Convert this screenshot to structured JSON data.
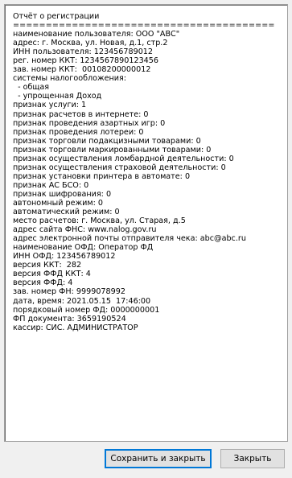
{
  "report": {
    "lines": [
      "Отчёт о регистрации",
      "========================================",
      "наименование пользователя: ООО \"АВС\"",
      "адрес: г. Москва, ул. Новая, д.1, стр.2",
      "ИНН пользователя: 123456789012",
      "рег. номер ККТ: 1234567890123456",
      "зав. номер ККТ:  00108200000012",
      "системы налогообложения:",
      "  - общая",
      "  - упрощенная Доход",
      "признак услуги: 1",
      "признак расчетов в интернете: 0",
      "признак проведения азартных игр: 0",
      "признак проведения лотереи: 0",
      "признак торговли подакцизными товарами: 0",
      "признак торговли маркированными товарами: 0",
      "признак осуществления ломбардной деятельности: 0",
      "признак осуществления страховой деятельности: 0",
      "признак установки принтера в автомате: 0",
      "признак АС БСО: 0",
      "признак шифрования: 0",
      "автономный режим: 0",
      "автоматический режим: 0",
      "место расчетов: г. Москва, ул. Старая, д.5",
      "адрес сайта ФНС: www.nalog.gov.ru",
      "адрес электронной почты отправителя чека: abc@abc.ru",
      "наименование ОФД: Оператор ФД",
      "ИНН ОФД: 123456789012",
      "версия ККТ:  282",
      "версия ФФД ККТ: 4",
      "версия ФФД: 4",
      "зав. номер ФН: 9999078992",
      "дата, время: 2021.05.15  17:46:00",
      "порядковый номер ФД: 0000000001",
      "ФП документа: 3659190524",
      "кассир: СИС. АДМИНИСТРАТОР"
    ]
  },
  "buttons": {
    "save_close": "Сохранить и закрыть",
    "close": "Закрыть"
  }
}
